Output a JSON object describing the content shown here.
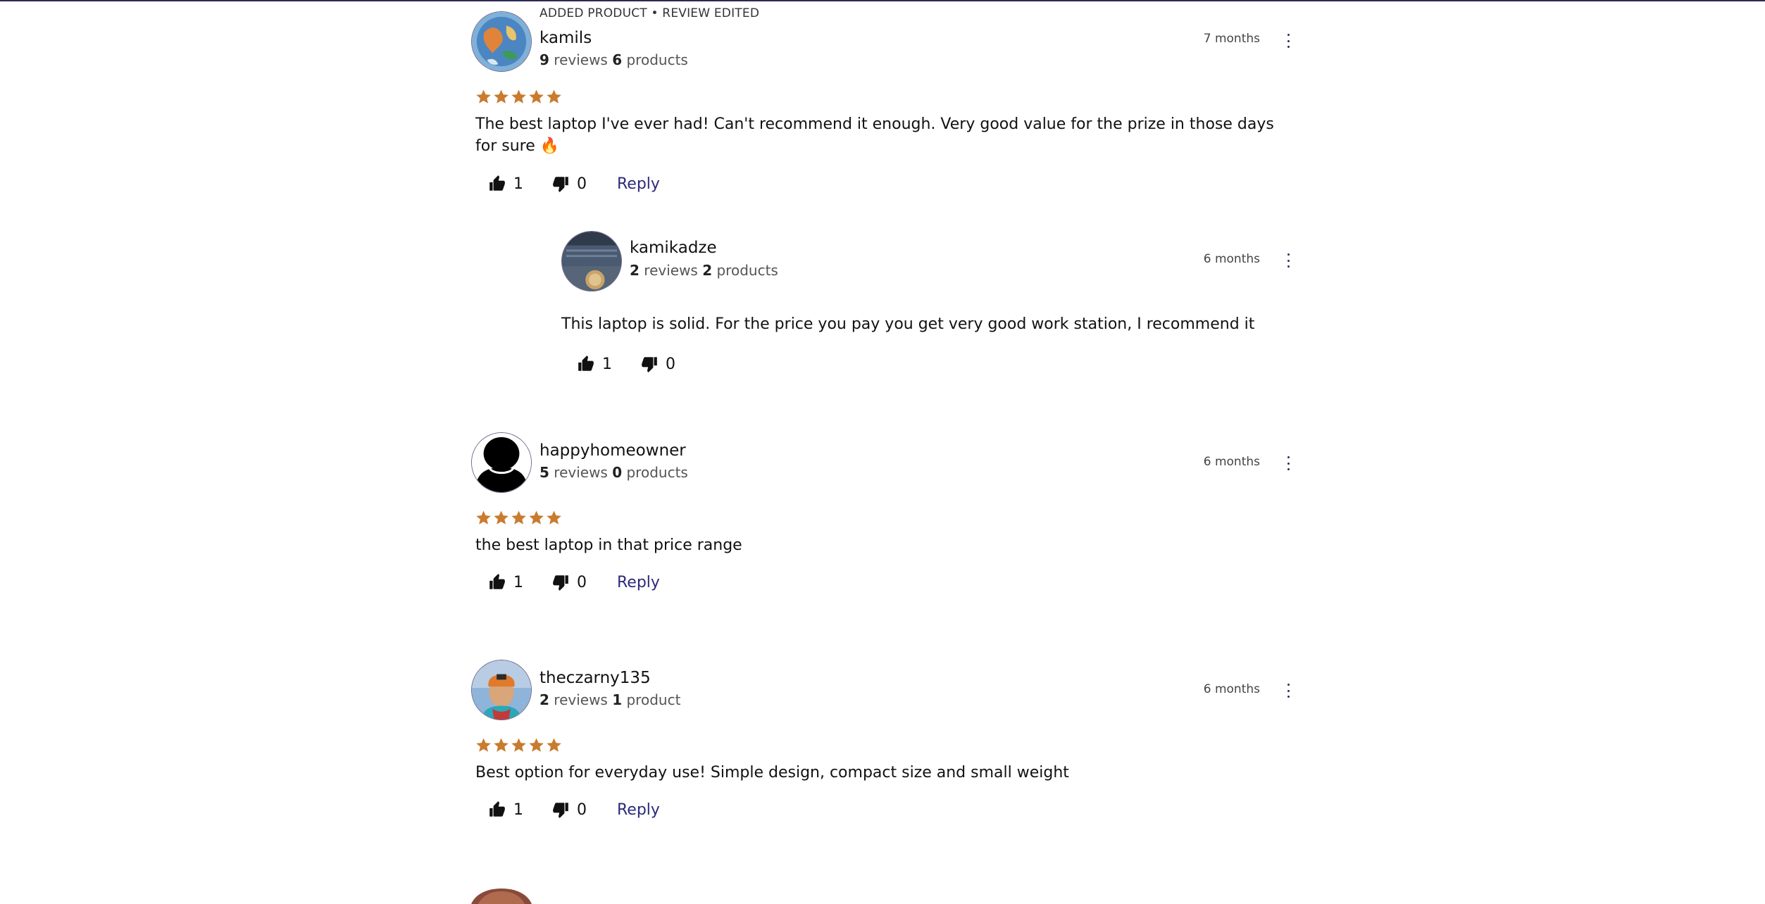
{
  "reviews": [
    {
      "meta": "ADDED PRODUCT • REVIEW EDITED",
      "username": "kamils",
      "reviews_count": "9",
      "reviews_word": "reviews",
      "products_count": "6",
      "products_word": "products",
      "time": "7 months",
      "rating": 5,
      "text": "The best laptop I've ever had! Can't recommend it enough. Very good value for the prize in those days for sure 🔥",
      "likes": "1",
      "dislikes": "0",
      "reply_label": "Reply",
      "replies": [
        {
          "username": "kamikadze",
          "reviews_count": "2",
          "reviews_word": "reviews",
          "products_count": "2",
          "products_word": "products",
          "time": "6 months",
          "text": "This laptop is solid. For the price you pay you get very good work station, I recommend it",
          "likes": "1",
          "dislikes": "0"
        }
      ]
    },
    {
      "username": "happyhomeowner",
      "reviews_count": "5",
      "reviews_word": "reviews",
      "products_count": "0",
      "products_word": "products",
      "time": "6 months",
      "rating": 5,
      "text": "the best laptop in that price range",
      "likes": "1",
      "dislikes": "0",
      "reply_label": "Reply"
    },
    {
      "username": "theczarny135",
      "reviews_count": "2",
      "reviews_word": "reviews",
      "products_count": "1",
      "products_word": "product",
      "time": "6 months",
      "rating": 5,
      "text": "Best option for everyday use! Simple design, compact size and small weight",
      "likes": "1",
      "dislikes": "0",
      "reply_label": "Reply"
    }
  ],
  "colors": {
    "star": "#c97b2e",
    "accent": "#2b2a7a",
    "top_border": "#2b2a55"
  },
  "icons": [
    "thumbs-up-icon",
    "thumbs-down-icon",
    "more-options-icon",
    "star-icon"
  ]
}
